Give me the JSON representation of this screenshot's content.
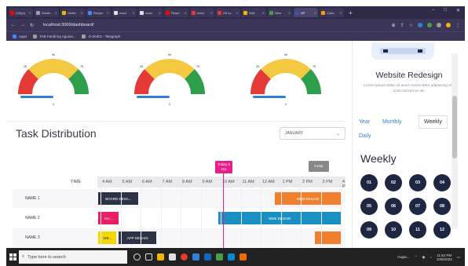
{
  "browser": {
    "tabs": [
      {
        "label": "(18)(4)",
        "color": "#ff0000",
        "active": false
      },
      {
        "label": "Studio",
        "color": "#9e9e9e",
        "active": false
      },
      {
        "label": "Gettin",
        "color": "#f4b400",
        "active": false
      },
      {
        "label": "Recipe",
        "color": "#4285f4",
        "active": false
      },
      {
        "label": "react",
        "color": "#e0e0e0",
        "active": false
      },
      {
        "label": "react",
        "color": "#e0e0e0",
        "active": false
      },
      {
        "label": "React",
        "color": "#ff0000",
        "active": false
      },
      {
        "label": "react",
        "color": "#e53935",
        "active": false
      },
      {
        "label": "Git co",
        "color": "#e53935",
        "active": false
      },
      {
        "label": "Wiki",
        "color": "#f4b400",
        "active": false
      },
      {
        "label": "New",
        "color": "#43a047",
        "active": false
      },
      {
        "label": "AP",
        "color": "#3f51b5",
        "active": true
      },
      {
        "label": "Cube",
        "color": "#ff9800",
        "active": false
      }
    ],
    "new_tab": "+",
    "window_controls": [
      "–",
      "□",
      "✕"
    ],
    "url": "localhost:3000/dashboard/",
    "bookmarks": [
      {
        "label": "Apps",
        "color": "#4285f4"
      },
      {
        "label": "TAB Fanbring Agunia...",
        "color": "#9e9e9e"
      },
      {
        "label": "O-SHES - Telegraph",
        "color": "#9e9e9e"
      }
    ]
  },
  "gauges": [
    {
      "ticks": [
        "0",
        "25",
        "50",
        "75",
        "100"
      ],
      "needle": "0"
    },
    {
      "ticks": [
        "0",
        "25",
        "50",
        "75",
        "100"
      ],
      "needle": "0"
    },
    {
      "ticks": [
        "0",
        "25",
        "50",
        "75",
        "100"
      ],
      "needle": "0"
    }
  ],
  "task": {
    "title": "Task Distribution",
    "month": "JANUARY",
    "time_label": "TIME",
    "ticks": [
      "4 AM",
      "5 AM",
      "6 AM",
      "7 AM",
      "8 AM",
      "9 AM",
      "10 AM",
      "11 AM",
      "12 AM",
      "1 PM",
      "2 PM",
      "3 PM",
      "4 P"
    ],
    "today_flag": "Today 8 Oct",
    "next_flag": "5 Mar",
    "rows": [
      {
        "name": "NAME 1",
        "bars": [
          {
            "label": "BOARD DESA...",
            "color": "#2b3345",
            "start": 3.9,
            "end": 5.9
          },
          {
            "label": "WEB DESAIN",
            "color": "#f07f2e",
            "start": 12.7,
            "end": 16.0
          }
        ]
      },
      {
        "name": "NAME 2",
        "bars": [
          {
            "label": "DA...",
            "color": "#e91e63",
            "start": 3.9,
            "end": 4.9
          },
          {
            "label": "WEB DESAIN",
            "color": "#1a8fc2",
            "start": 9.9,
            "end": 16.0
          }
        ]
      },
      {
        "name": "NAME 3",
        "bars": [
          {
            "label": "WE...",
            "color": "#f5d800",
            "start": 3.9,
            "end": 4.8
          },
          {
            "label": "APP DESAIN",
            "color": "#2b3345",
            "start": 4.9,
            "end": 6.8
          },
          {
            "label": "",
            "color": "#f07f2e",
            "start": 14.7,
            "end": 16.0
          }
        ]
      }
    ]
  },
  "sidebar": {
    "title": "Website Redesign",
    "description": "Lorem ipsum dolor sit amet consectetur adipiscing elit. Cum mirrors ex ab.",
    "tabs": {
      "year": "Year",
      "monthly": "Monthly",
      "weekly": "Weekly",
      "daily": "Daily"
    },
    "weekly_heading": "Weekly",
    "weeks": [
      "01",
      "02",
      "03",
      "04",
      "05",
      "06",
      "07",
      "08",
      "09",
      "10",
      "11",
      "12"
    ]
  },
  "taskbar": {
    "search_placeholder": "Type here to search",
    "weather": "Hujan...",
    "time": "11:52 PM",
    "date": "10/8/2022"
  },
  "colors": {
    "chrome_dark": "#2f2a47",
    "chrome": "#3b3657",
    "gauge_red": "#e53935",
    "gauge_yellow": "#f5c842",
    "gauge_green": "#2e9e4a",
    "gauge_progress": "#2f80d8",
    "week_circle": "#1e2742",
    "today": "#e91e8c"
  }
}
